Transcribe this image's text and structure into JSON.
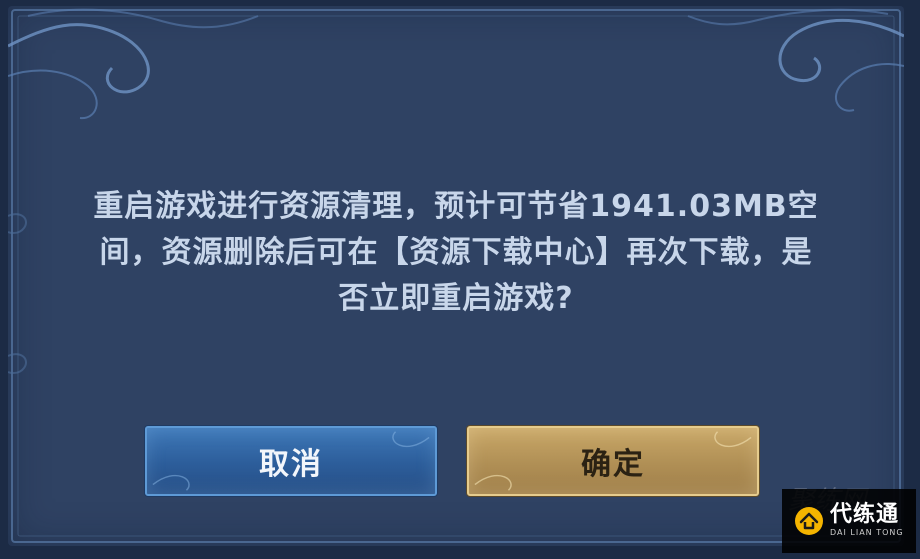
{
  "dialog": {
    "message_lines": [
      "重启游戏进行资源清理，预计可节省1941.03MB空",
      "间，资源删除后可在【资源下载中心】再次下载，是",
      "否立即重启游戏?"
    ]
  },
  "buttons": {
    "cancel_label": "取消",
    "confirm_label": "确定"
  },
  "watermark": {
    "name": "代练通",
    "subtitle": "DAI LIAN TONG",
    "faint_mark": "聚练网"
  },
  "colors": {
    "dialog_bg": "#2f4263",
    "cancel_accent": "#3e78b8",
    "confirm_accent": "#c9a868",
    "text": "#c8d6ea"
  },
  "icons": {
    "watermark_logo": "house-logo-icon",
    "frame_ornament": "cloud-swirl-ornament"
  }
}
